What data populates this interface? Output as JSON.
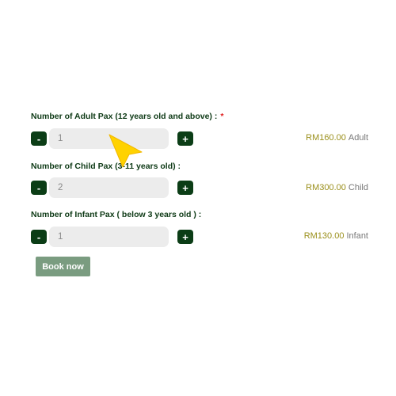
{
  "adult": {
    "label": "Number of Adult Pax (12 years old and above) :",
    "required_mark": "*",
    "minus": "-",
    "value": "1",
    "plus": "+",
    "price": "RM160.00",
    "unit": "Adult"
  },
  "child": {
    "label": "Number of Child Pax (3-11 years old) :",
    "minus": "-",
    "value": "2",
    "plus": "+",
    "price": "RM300.00",
    "unit": "Child"
  },
  "infant": {
    "label": "Number of Infant Pax ( below 3 years old ) :",
    "minus": "-",
    "value": "1",
    "plus": "+",
    "price": "RM130.00",
    "unit": "Infant"
  },
  "book_button": "Book now",
  "colors": {
    "button_dark": "#0b3d16",
    "label": "#0e3a16",
    "price": "#9a8f1a",
    "required": "#e02020",
    "book_button": "#7a9c80",
    "cursor": "#ffd200"
  },
  "cursor_icon": "pointer-arrow-icon"
}
